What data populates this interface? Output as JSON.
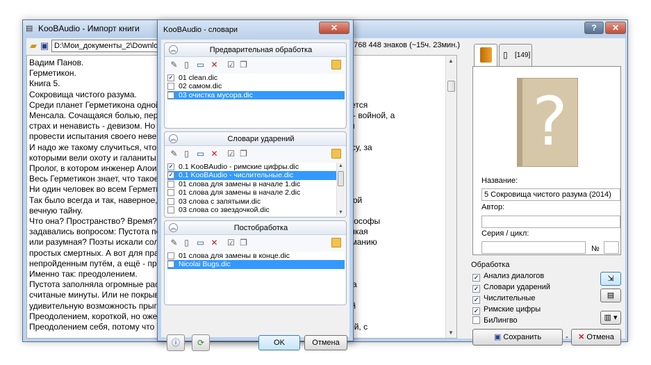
{
  "main_window": {
    "title": "KooBAudio - Импорт книги",
    "help_label": "?",
    "close_label": "✕",
    "path": "D:\\Мои_документы_2\\Download",
    "char_count": "768 448 знаков (~15ч. 23мин.)",
    "text_lines": [
      "Вадим Панов.",
      "Герметикон.",
      "Книга 5.",
      "Сокровища чистого разума.",
      "",
      "Среди планет Герметикона одной                                                    лишним лет считается",
      "Менсала. Сочащаяся болью, переп                                                   проклятием, мир - войной, а",
      "страх и ненависть - девизом. Но им                                                 женер Холь решил",
      "провести испытания своего невер",
      "И надо же такому случиться, что и                                                 и Андреаса О. Мерсу, за",
      "которыми вели охоту и галаниты, и",
      "",
      "Пролог, в котором инженер Алоизи",
      "",
      "Весь Герметикон знает, что такое",
      "Ни один человек во всем Герметик",
      "Так было всегда и так, наверное, с                                                 Пустота являет собой",
      "вечную тайну.",
      "Что она? Пространство? Время? П                                                   тствие мира? Философы",
      "задавались вопросом: Пустота пе                                                    вающая жизнь? Дикая",
      "или разумная? Поэты искали соль                                                    едоступным пониманию",
      "простых смертных. А вот для прагм                                                  ойденным или",
      "непройденным путём, а ещё - преод                                                  ойденным",
      "Именно так: преодолением.",
      "Пустота заполняла огромные расс                                                     и покрывали их за",
      "считаные минуты. Или не покрыва                                                     ный налог за",
      "удивительную возможность прыга                                                     была для цепарей",
      "Преодолением, короткой, но ожест                                                    сделать шаг.",
      "Преодолением себя, потому что ос                                                    бшивкой цеппелей, с"
    ]
  },
  "right_panel": {
    "tab_back_label": "[149]",
    "name_label": "Название:",
    "name_value": "5 Сокровища чистого разума (2014)",
    "author_label": "Автор:",
    "author_value": "",
    "series_label": "Серия / цикл:",
    "series_value": "",
    "num_sign": "№",
    "num_value": "",
    "processing_label": "Обработка",
    "options": [
      {
        "label": "Анализ диалогов",
        "checked": true
      },
      {
        "label": "Словари ударений",
        "checked": true
      },
      {
        "label": "Числительные",
        "checked": true
      },
      {
        "label": "Римские цифры",
        "checked": true
      },
      {
        "label": "БиЛингво",
        "checked": false
      }
    ],
    "save_label": "Сохранить",
    "cancel_label": "Отмена"
  },
  "dialog": {
    "title": "KooBAudio - словари",
    "close_label": "✕",
    "groups": [
      {
        "title": "Предварительная обработка",
        "items": [
          {
            "label": "01 clean.dic",
            "checked": true,
            "selected": false
          },
          {
            "label": "02 самом.dic",
            "checked": false,
            "selected": false
          },
          {
            "label": "03 очистка мусора.dic",
            "checked": false,
            "selected": true
          }
        ]
      },
      {
        "title": "Словари ударений",
        "items": [
          {
            "label": "0.1 KooBAudio - римские цифры.dic",
            "checked": true,
            "selected": false
          },
          {
            "label": "0.1 KooBAudio - числительные.dic",
            "checked": true,
            "selected": true
          },
          {
            "label": "01 слова для замены в начале 1.dic",
            "checked": false,
            "selected": false
          },
          {
            "label": "01 слова для замены в начале 2.dic",
            "checked": false,
            "selected": false
          },
          {
            "label": "03 слова с запятыми.dic",
            "checked": false,
            "selected": false
          },
          {
            "label": "03 слова со звездочкой.dic",
            "checked": false,
            "selected": false
          }
        ]
      },
      {
        "title": "Постобработка",
        "items": [
          {
            "label": "01 слова для замены в конце.dic",
            "checked": false,
            "selected": false
          },
          {
            "label": "Nicolai Bugs.dic",
            "checked": false,
            "selected": true
          }
        ]
      }
    ],
    "ok_label": "OK",
    "cancel_label": "Отмена"
  },
  "colors": {
    "selection": "#3399ff",
    "frame": "#bcd3ee",
    "close_button": "#c44a35"
  },
  "icons": {
    "folder": "folder-open-icon",
    "save": "floppy-icon",
    "book": "book-icon",
    "info": "info-icon",
    "refresh": "refresh-icon"
  }
}
